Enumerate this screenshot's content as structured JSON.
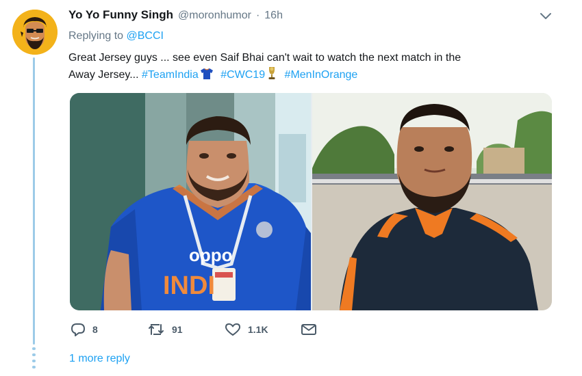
{
  "tweet": {
    "author": {
      "display_name": "Yo Yo Funny Singh",
      "handle": "@moronhumor",
      "separator": "·",
      "time": "16h",
      "avatar_icon": "avatar-cartoon-face"
    },
    "replying_to": {
      "prefix": "Replying to",
      "handle": "@BCCI"
    },
    "text": {
      "line1": "Great Jersey guys ... see even Saif Bhai can't wait to watch the next match in the",
      "line2_plain": "Away Jersey...",
      "hashtags": [
        "#TeamIndia",
        "#CWC19",
        "#MenInOrange"
      ],
      "emojis": [
        "jersey-emoji",
        "trophy-emoji"
      ]
    },
    "media": {
      "left_photo": {
        "description_icon": "photo-man-blue-jersey",
        "jersey_text_top": "oppo",
        "jersey_text_bottom": "INDI"
      },
      "right_photo": {
        "description_icon": "photo-man-orange-collar"
      }
    },
    "actions": {
      "reply_count": "8",
      "retweet_count": "91",
      "like_count": "1.1K",
      "icons": [
        "reply-icon",
        "retweet-icon",
        "like-icon",
        "message-icon"
      ]
    },
    "more_reply_label": "1 more reply"
  },
  "colors": {
    "accent": "#1da1f2",
    "thread_line": "#9ccbe8",
    "secondary_text": "#657786",
    "avatar_bg": "#f3b21a"
  }
}
